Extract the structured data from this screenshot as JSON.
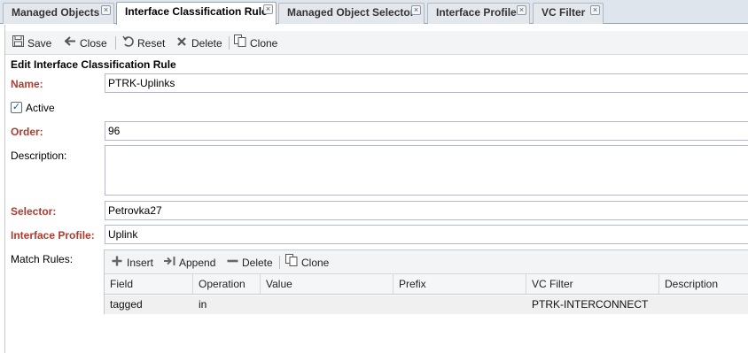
{
  "tabs": [
    {
      "label": "Managed Objects",
      "close": "×"
    },
    {
      "label": "Interface Classification Rule",
      "close": "×"
    },
    {
      "label": "Managed Object Selector",
      "close": "×"
    },
    {
      "label": "Interface Profile",
      "close": "×"
    },
    {
      "label": "VC Filter",
      "close": "×"
    }
  ],
  "toolbar": {
    "save": "Save",
    "close": "Close",
    "reset": "Reset",
    "delete": "Delete",
    "clone": "Clone"
  },
  "form": {
    "title": "Edit Interface Classification Rule",
    "name_label": "Name:",
    "name_value": "PTRK-Uplinks",
    "active_label": "Active",
    "active_checked": true,
    "order_label": "Order:",
    "order_value": "96",
    "description_label": "Description:",
    "description_value": "",
    "selector_label": "Selector:",
    "selector_value": "Petrovka27",
    "profile_label": "Interface Profile:",
    "profile_value": "Uplink",
    "match_rules_label": "Match Rules:"
  },
  "match_rules": {
    "toolbar": {
      "insert": "Insert",
      "append": "Append",
      "delete": "Delete",
      "clone": "Clone"
    },
    "columns": [
      "Field",
      "Operation",
      "Value",
      "Prefix",
      "VC Filter",
      "Description"
    ],
    "rows": [
      {
        "field": "tagged",
        "operation": "in",
        "value": "",
        "prefix": "",
        "vc_filter": "PTRK-INTERCONNECT",
        "description": ""
      }
    ]
  },
  "icons": {
    "save": "floppy-icon",
    "close": "arrow-left-icon",
    "reset": "undo-icon",
    "delete": "x-icon",
    "clone": "copy-icon",
    "insert": "plus-icon",
    "append": "append-icon",
    "grid_delete": "minus-icon"
  },
  "colors": {
    "required_label": "#b23a2e",
    "tab_bar": "#dfe5ec",
    "toolbar": "#f2f4f6"
  }
}
